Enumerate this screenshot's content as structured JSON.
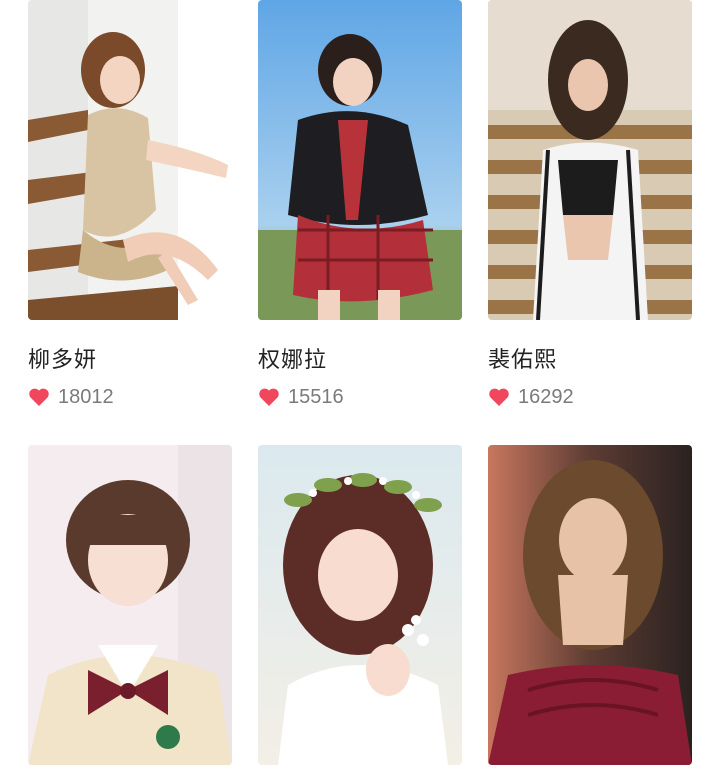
{
  "colors": {
    "heart": "#f0475c",
    "name_text": "#222222",
    "count_text": "#7a7a7a"
  },
  "gallery": {
    "items": [
      {
        "name": "柳多妍",
        "likes": "18012",
        "heart_icon": "heart-icon"
      },
      {
        "name": "权娜拉",
        "likes": "15516",
        "heart_icon": "heart-icon"
      },
      {
        "name": "裴佑熙",
        "likes": "16292",
        "heart_icon": "heart-icon"
      },
      {
        "name": "",
        "likes": "",
        "heart_icon": "heart-icon"
      },
      {
        "name": "",
        "likes": "",
        "heart_icon": "heart-icon"
      },
      {
        "name": "",
        "likes": "",
        "heart_icon": "heart-icon"
      }
    ]
  }
}
